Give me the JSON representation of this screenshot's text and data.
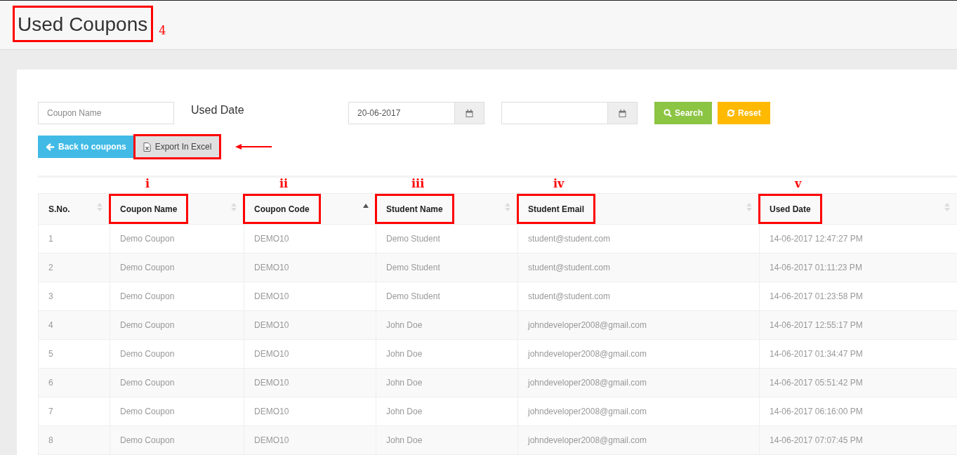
{
  "page": {
    "title": "Used Coupons",
    "title_highlighted": true,
    "annotation": "4"
  },
  "filters": {
    "coupon_name": {
      "placeholder": "Coupon Name"
    },
    "used_date_label": "Used Date",
    "date_from": {
      "value": "20-06-2017"
    },
    "search_button": "Search",
    "reset_button": "Reset"
  },
  "actions": [
    {
      "kind": "back",
      "label": "Back to coupons",
      "highlighted": false
    },
    {
      "kind": "export",
      "label": "Export In Excel",
      "highlighted": true,
      "arrow": true
    }
  ],
  "table": {
    "columns": [
      {
        "label": "S.No.",
        "sorted": false,
        "highlighted": false
      },
      {
        "label": "Coupon Name",
        "sorted": false,
        "highlighted": true,
        "annotation": "i"
      },
      {
        "label": "Coupon Code",
        "sorted": true,
        "highlighted": true,
        "annotation": "ii"
      },
      {
        "label": "Student Name",
        "sorted": false,
        "highlighted": true,
        "annotation": "iii"
      },
      {
        "label": "Student Email",
        "sorted": false,
        "highlighted": true,
        "annotation": "iv"
      },
      {
        "label": "Used Date",
        "sorted": false,
        "highlighted": true,
        "annotation": "v"
      }
    ],
    "rows": [
      [
        "1",
        "Demo Coupon",
        "DEMO10",
        "Demo Student",
        "student@student.com",
        "14-06-2017 12:47:27 PM"
      ],
      [
        "2",
        "Demo Coupon",
        "DEMO10",
        "Demo Student",
        "student@student.com",
        "14-06-2017 01:11:23 PM"
      ],
      [
        "3",
        "Demo Coupon",
        "DEMO10",
        "Demo Student",
        "student@student.com",
        "14-06-2017 01:23:58 PM"
      ],
      [
        "4",
        "Demo Coupon",
        "DEMO10",
        "John Doe",
        "johndeveloper2008@gmail.com",
        "14-06-2017 12:55:17 PM"
      ],
      [
        "5",
        "Demo Coupon",
        "DEMO10",
        "John Doe",
        "johndeveloper2008@gmail.com",
        "14-06-2017 01:34:47 PM"
      ],
      [
        "6",
        "Demo Coupon",
        "DEMO10",
        "John Doe",
        "johndeveloper2008@gmail.com",
        "14-06-2017 05:51:42 PM"
      ],
      [
        "7",
        "Demo Coupon",
        "DEMO10",
        "John Doe",
        "johndeveloper2008@gmail.com",
        "14-06-2017 06:16:00 PM"
      ],
      [
        "8",
        "Demo Coupon",
        "DEMO10",
        "John Doe",
        "johndeveloper2008@gmail.com",
        "14-06-2017 07:07:45 PM"
      ]
    ]
  }
}
